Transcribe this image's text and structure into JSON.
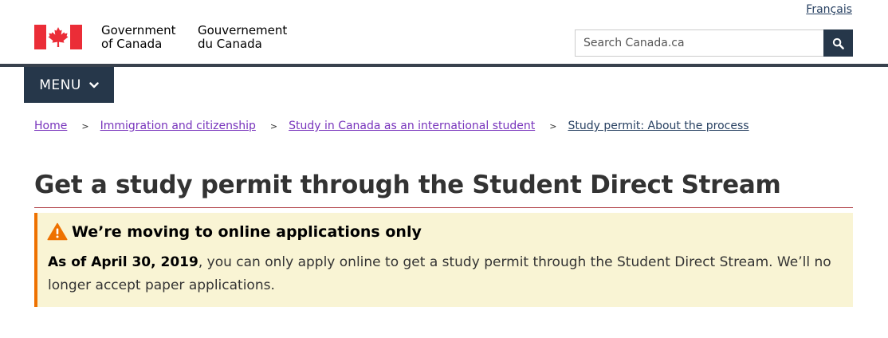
{
  "header": {
    "language_toggle": "Français",
    "signature_en_line1": "Government",
    "signature_en_line2": "of Canada",
    "signature_fr_line1": "Gouvernement",
    "signature_fr_line2": "du Canada",
    "search_placeholder": "Search Canada.ca"
  },
  "menu": {
    "label": "MENU"
  },
  "breadcrumb": {
    "items": [
      "Home",
      "Immigration and citizenship",
      "Study in Canada as an international student",
      "Study permit: About the process"
    ],
    "separator": ">"
  },
  "main": {
    "title": "Get a study permit through the Student Direct Stream"
  },
  "alert": {
    "title": "We’re moving to online applications only",
    "body_bold": "As of April 30, 2019",
    "body_rest": ", you can only apply online to get a study permit through the Student Direct Stream. We’ll no longer accept paper applications."
  },
  "colors": {
    "brand_red": "#eb2d37",
    "nav_dark": "#26374a",
    "link_visited": "#7834bc",
    "link": "#284162",
    "alert_bg": "#f9f4d4",
    "alert_border": "#ee7100",
    "title_rule": "#af3c43"
  }
}
